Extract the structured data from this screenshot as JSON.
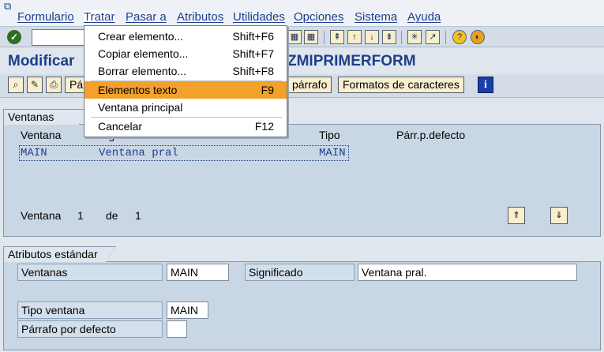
{
  "menubar": {
    "items": [
      "Formulario",
      "Tratar",
      "Pasar a",
      "Atributos",
      "Utilidades",
      "Opciones",
      "Sistema",
      "Ayuda"
    ]
  },
  "toolbar": {
    "command_value": ""
  },
  "title": {
    "left": "Modificar",
    "right": "ZMIPRIMERFORM"
  },
  "apptoolbar": {
    "btn_partial": "Pá",
    "btn_parrafo": "párrafo",
    "btn_formatos": "Formatos de caracteres"
  },
  "dropdown": {
    "items": [
      {
        "label": "Crear elemento...",
        "shortcut": "Shift+F6"
      },
      {
        "label": "Copiar elemento...",
        "shortcut": "Shift+F7"
      },
      {
        "label": "Borrar elemento...",
        "shortcut": "Shift+F8"
      },
      {
        "label": "Elementos texto",
        "shortcut": "F9"
      },
      {
        "label": "Ventana principal",
        "shortcut": ""
      },
      {
        "label": "Cancelar",
        "shortcut": "F12"
      }
    ]
  },
  "ventanas": {
    "title": "Ventanas",
    "columns": [
      "Ventana",
      "Significado",
      "Tipo",
      "Párr.p.defecto"
    ],
    "rows": [
      {
        "ventana": "MAIN",
        "significado": "Ventana pral",
        "tipo": "MAIN",
        "parr": ""
      }
    ],
    "pager": {
      "label": "Ventana",
      "current": "1",
      "of": "de",
      "total": "1"
    }
  },
  "atributos": {
    "title": "Atributos estándar",
    "ventanas_label": "Ventanas",
    "ventanas_value": "MAIN",
    "significado_label": "Significado",
    "significado_value": "Ventana pral.",
    "tipo_label": "Tipo ventana",
    "tipo_value": "MAIN",
    "parrafo_label": "Párrafo por defecto",
    "parrafo_value": ""
  },
  "colors": {
    "menu_text": "#1f3e8f",
    "title_text": "#1d3f8a",
    "highlight": "#f3a12a",
    "group_bg": "#c9d7e5"
  }
}
